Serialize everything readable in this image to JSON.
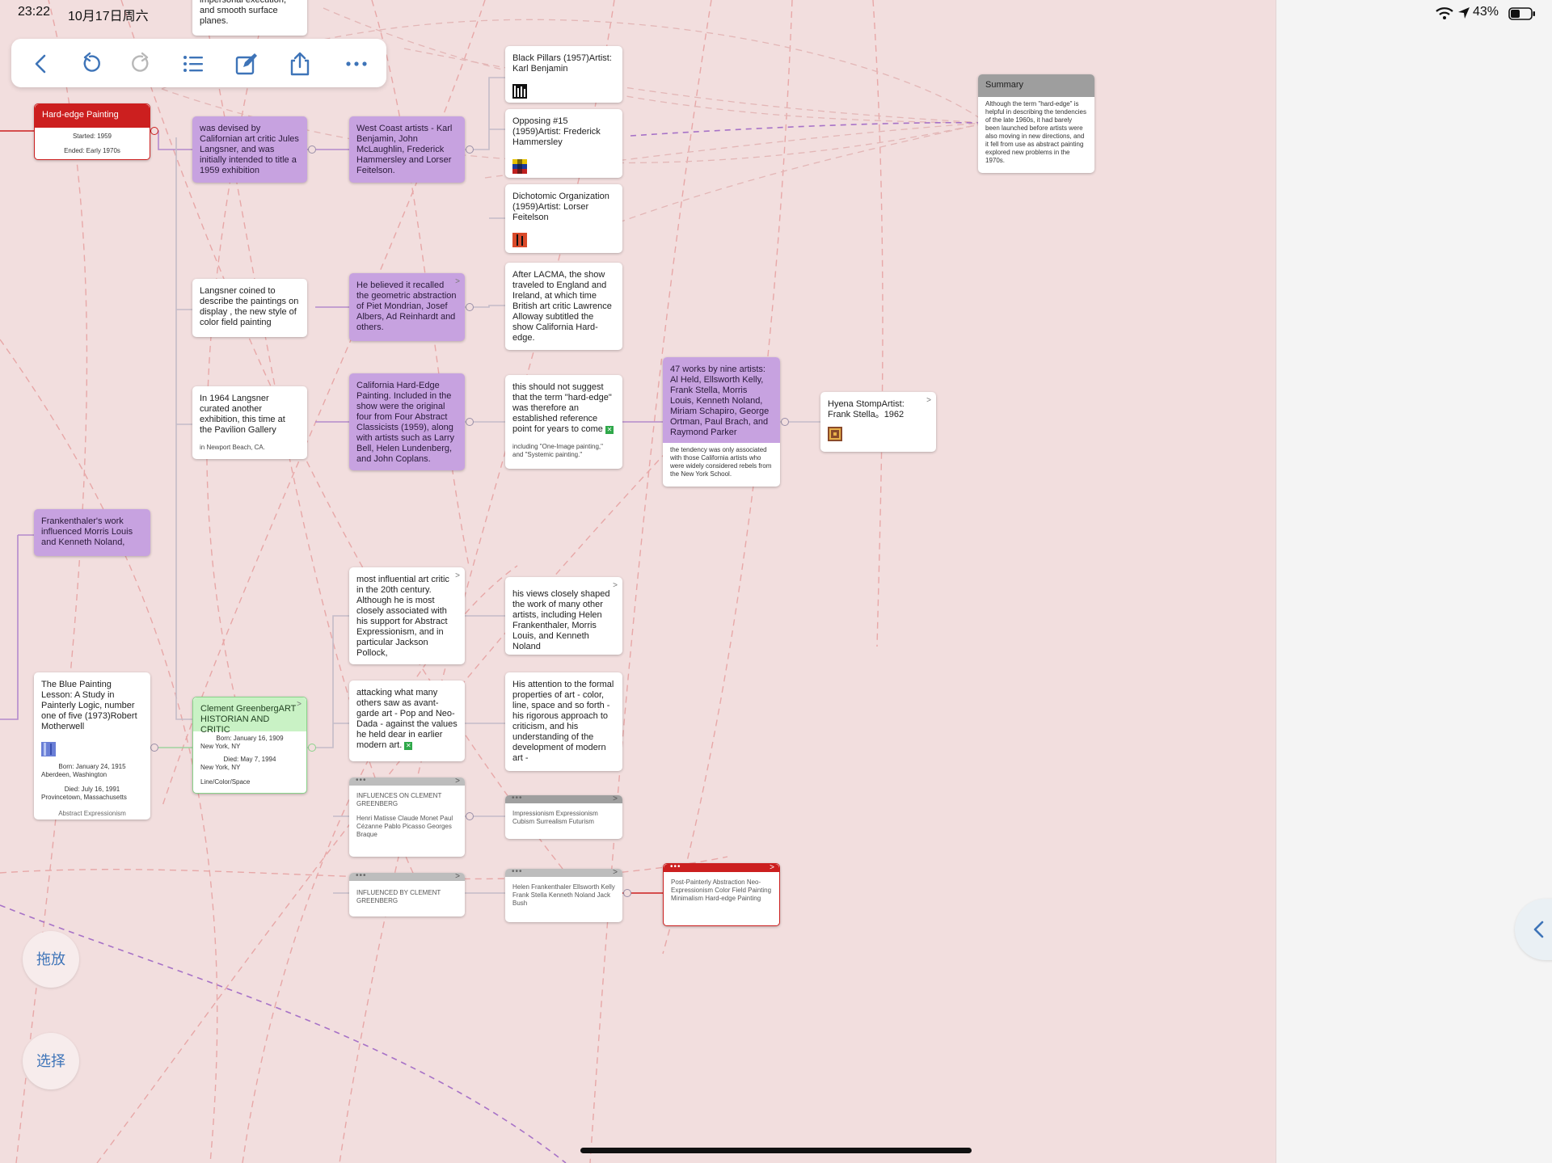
{
  "status_bar": {
    "time": "23:22",
    "date": "10月17日周六",
    "battery": "43%"
  },
  "toolbar": {
    "icons": [
      "back-icon",
      "undo-icon",
      "redo-icon",
      "list-icon",
      "edit-icon",
      "share-icon",
      "more-icon"
    ]
  },
  "side_buttons": {
    "drag": "拖放",
    "select": "选择"
  },
  "colors": {
    "canvas": "#f2dede",
    "purple": "#c7a2e0",
    "red": "#cc1f1f",
    "green": "#c9f2c5",
    "accent": "#3e74b8"
  },
  "nodes": {
    "top_partial": "impersonal execution, and smooth surface planes.",
    "hard_edge": {
      "title": "Hard-edge Painting",
      "started": "Started: 1959",
      "ended": "Ended: Early 1970s"
    },
    "devised": "was devised by Californian art critic Jules Langsner, and was initially intended to title a 1959 exhibition",
    "west_coast": "West Coast artists - Karl Benjamin, John McLaughlin, Frederick Hammersley and Lorser Feitelson.",
    "black_pillars": "Black Pillars (1957)Artist: Karl Benjamin",
    "opposing": "Opposing #15 (1959)Artist: Frederick Hammersley",
    "dichotomic": "Dichotomic Organization (1959)Artist: Lorser Feitelson",
    "summary": {
      "title": "Summary",
      "text": "Although the term \"hard-edge\" is helpful in describing the tendencies of the late 1960s, it had barely been launched before artists were also moving in new directions, and it fell from use as abstract painting explored new problems in the 1970s."
    },
    "langsner_coined": "Langsner coined to describe the paintings on display , the new style of color field painting",
    "recalled": "He believed it recalled the geometric abstraction of Piet Mondrian, Josef Albers, Ad Reinhardt and others.",
    "after_lacma": "After LACMA, the show traveled to England and Ireland, at which time British art critic Lawrence Alloway subtitled the show California Hard-edge.",
    "in_1964": {
      "text": "In 1964 Langsner curated another exhibition, this time at the Pavilion Gallery",
      "caption": "in Newport Beach, CA."
    },
    "california": "California Hard-Edge Painting. Included in the show were the original four from Four Abstract Classicists (1959), along with artists such as Larry Bell, Helen Lundenberg, and John Coplans.",
    "should_not": {
      "text": "this should not suggest that the term \"hard-edge\" was therefore an established reference point for years to come",
      "caption": "including \"One-Image painting,\" and \"Systemic painting.\""
    },
    "works47": {
      "text": "47 works by nine artists: Al Held, Ellsworth Kelly, Frank Stella, Morris Louis, Kenneth Noland, Miriam Schapiro, George Ortman, Paul Brach, and Raymond Parker",
      "caption": "the tendency was only associated with those California artists who were widely considered rebels from the New York School."
    },
    "hyena": "Hyena StompArtist: Frank Stella。1962",
    "frankenthaler": "Frankenthaler's work influenced Morris Louis and Kenneth Noland,",
    "most_influential": "most influential art critic in the 20th century. Although he is most closely associated with his support for Abstract Expressionism, and in particular Jackson Pollock,",
    "views": "his views closely shaped the work of many other artists, including Helen Frankenthaler, Morris Louis, and Kenneth Noland",
    "blue_painting": {
      "text": "The Blue Painting Lesson: A Study in Painterly Logic, number one of five (1973)Robert Motherwell",
      "born": "Born: January 24, 1915",
      "born_place": "Aberdeen, Washington",
      "died": "Died: July 16, 1991",
      "died_place": "Provincetown, Massachusetts",
      "tag": "Abstract Expressionism"
    },
    "greenberg": {
      "title": "Clement GreenbergART HISTORIAN AND CRITIC",
      "born": "Born: January 16, 1909",
      "born_place": "New York, NY",
      "died": "Died: May 7, 1994",
      "died_place": "New York, NY",
      "tag": "Line/Color/Space"
    },
    "attacking": "attacking what many others saw as avant-garde art - Pop and Neo-Dada - against the values he held dear in earlier modern art.",
    "attention": "His attention to the formal properties of art - color, line, space and so forth - his rigorous approach to criticism, and his understanding of the development of modern art -",
    "influences_on": {
      "title": "INFLUENCES ON CLEMENT GREENBERG",
      "text": "Henri Matisse Claude Monet Paul Cézanne Pablo Picasso Georges Braque"
    },
    "movements": "Impressionism Expressionism Cubism Surrealism Futurism",
    "influenced_by": "INFLUENCED BY CLEMENT GREENBERG",
    "helen": "Helen Frankenthaler Ellsworth Kelly Frank Stella Kenneth Noland Jack Bush",
    "post_painterly": "Post-Painterly Abstraction Neo-Expressionism Color Field Painting Minimalism Hard-edge Painting"
  }
}
